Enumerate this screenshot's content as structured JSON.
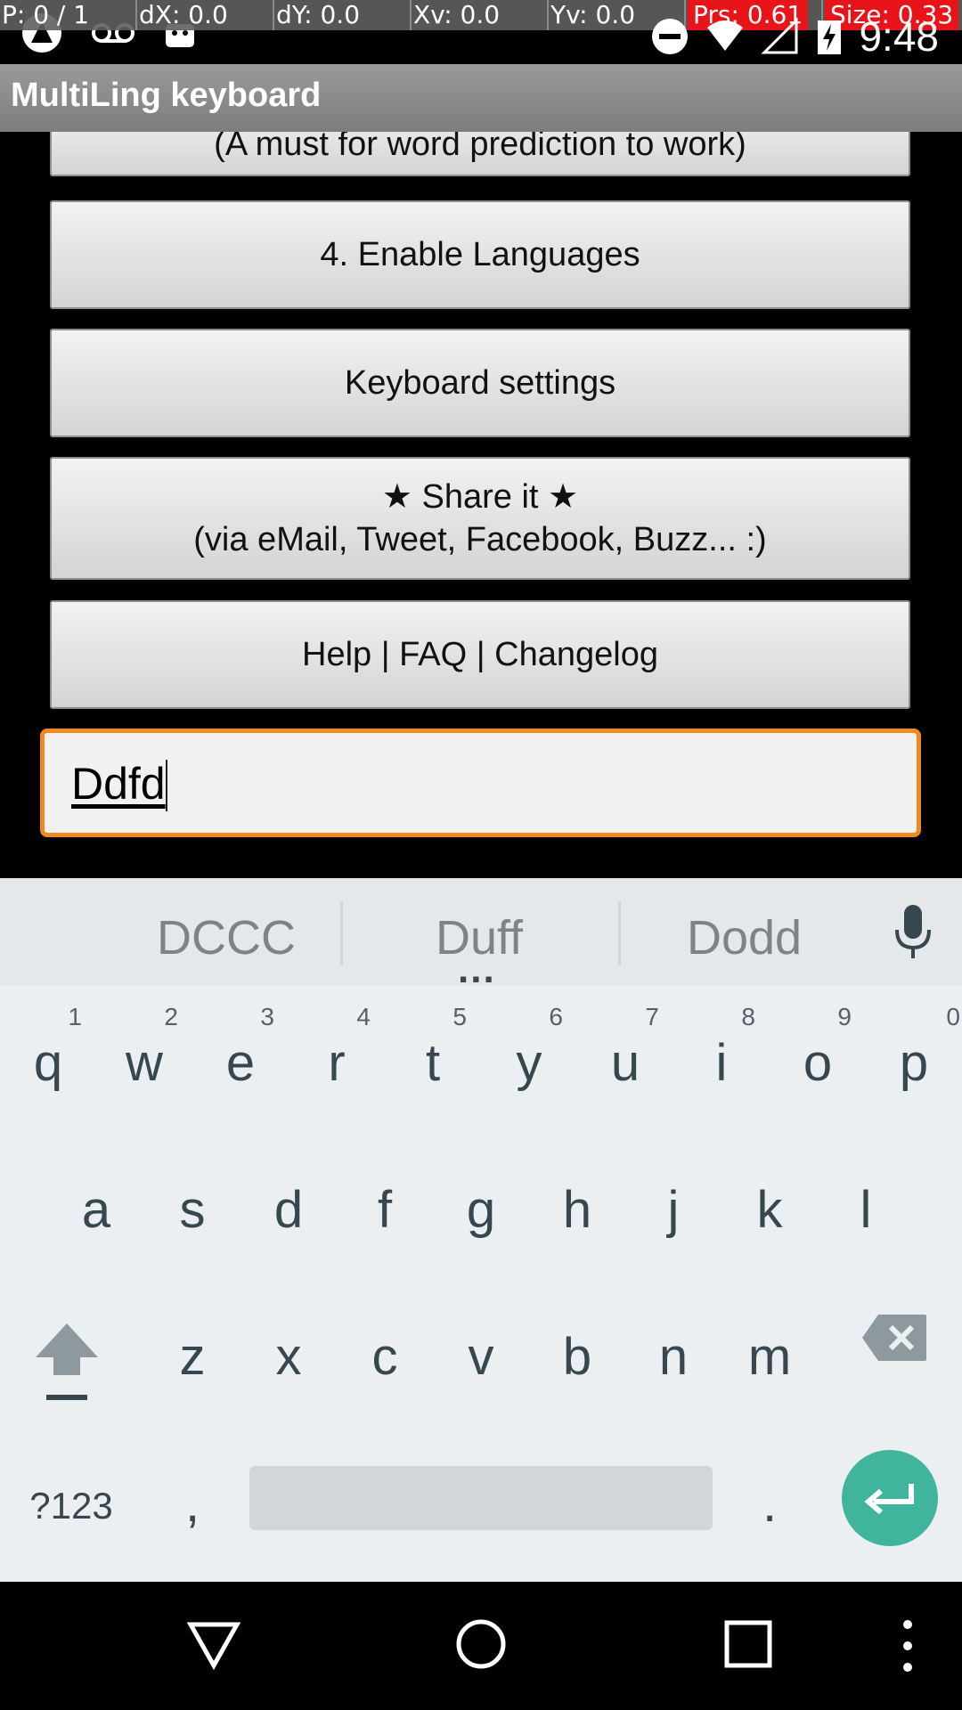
{
  "status_bar": {
    "pointer_location": {
      "p": "P: 0 / 1",
      "dx": "dX: 0.0",
      "dy": "dY: 0.0",
      "xv": "Xv: 0.0",
      "yv": "Yv: 0.0",
      "prs": "Prs: 0.61",
      "size": "Size: 0.33"
    },
    "time": "9:48",
    "icons": [
      "app-notification-icon",
      "voicemail-icon",
      "android-icon",
      "do-not-disturb-icon",
      "wifi-icon",
      "signal-icon",
      "battery-charging-icon"
    ]
  },
  "app_bar": {
    "title": "MultiLing keyboard"
  },
  "buttons": {
    "prediction_note": "(A must for word prediction to work)",
    "enable_languages": "4. Enable Languages",
    "keyboard_settings": "Keyboard settings",
    "share_line1": "★ Share it ★",
    "share_line2": "(via eMail, Tweet, Facebook, Buzz... :)",
    "help": "Help | FAQ | Changelog"
  },
  "text_field": {
    "value": "Ddfd"
  },
  "keyboard": {
    "suggestions": [
      "DCCC",
      "Duff",
      "Dodd"
    ],
    "more_indicator": "...",
    "row1": [
      {
        "key": "q",
        "hint": "1"
      },
      {
        "key": "w",
        "hint": "2"
      },
      {
        "key": "e",
        "hint": "3"
      },
      {
        "key": "r",
        "hint": "4"
      },
      {
        "key": "t",
        "hint": "5"
      },
      {
        "key": "y",
        "hint": "6"
      },
      {
        "key": "u",
        "hint": "7"
      },
      {
        "key": "i",
        "hint": "8"
      },
      {
        "key": "o",
        "hint": "9"
      },
      {
        "key": "p",
        "hint": "0"
      }
    ],
    "row2": [
      "a",
      "s",
      "d",
      "f",
      "g",
      "h",
      "j",
      "k",
      "l"
    ],
    "row3": [
      "z",
      "x",
      "c",
      "v",
      "b",
      "n",
      "m"
    ],
    "symbols_label": "?123",
    "comma": ",",
    "period": ".",
    "accent_color": "#40b49c",
    "focus_color": "#f08a1e"
  },
  "nav_bar": {
    "icons": [
      "back-icon",
      "home-icon",
      "recents-icon",
      "menu-icon"
    ]
  }
}
